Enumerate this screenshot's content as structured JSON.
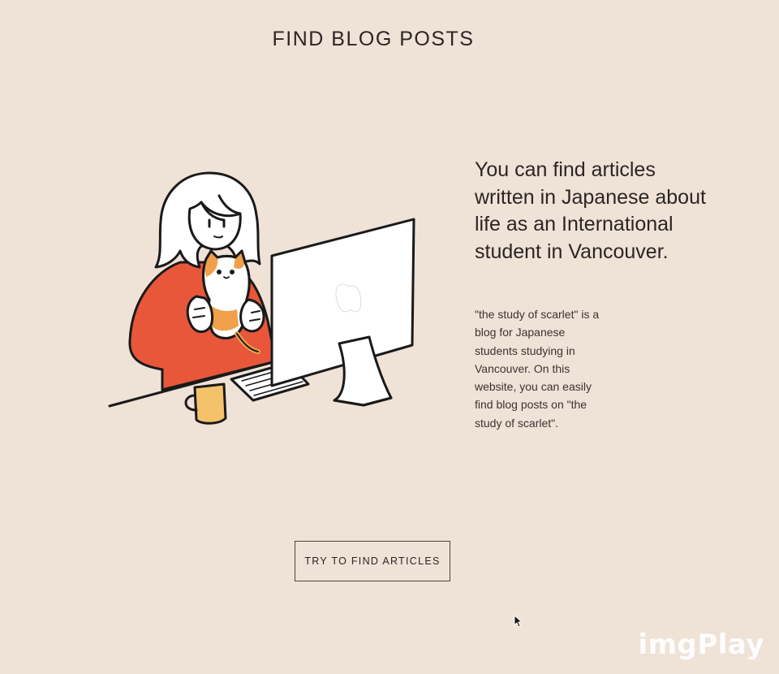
{
  "header": {
    "title": "FIND BLOG POSTS"
  },
  "hero": {
    "illustration_icon": "person-with-cat-at-computer-illustration",
    "headline": "You can find articles written in Japanese about life as an International student in Vancouver.",
    "description": "\"the study of scarlet\" is a blog for Japanese students studying in Vancouver. On this website, you can easily find blog posts on \"the study of scarlet\"."
  },
  "cta": {
    "label": "TRY TO FIND ARTICLES"
  },
  "overlay": {
    "cursor_icon": "mouse-pointer-icon",
    "watermark": "imgPlay"
  },
  "colors": {
    "background": "#efe2d7",
    "text": "#2b2623",
    "sweater": "#e8573a",
    "cat_orange": "#f0a04b",
    "mug": "#f3c26b"
  }
}
